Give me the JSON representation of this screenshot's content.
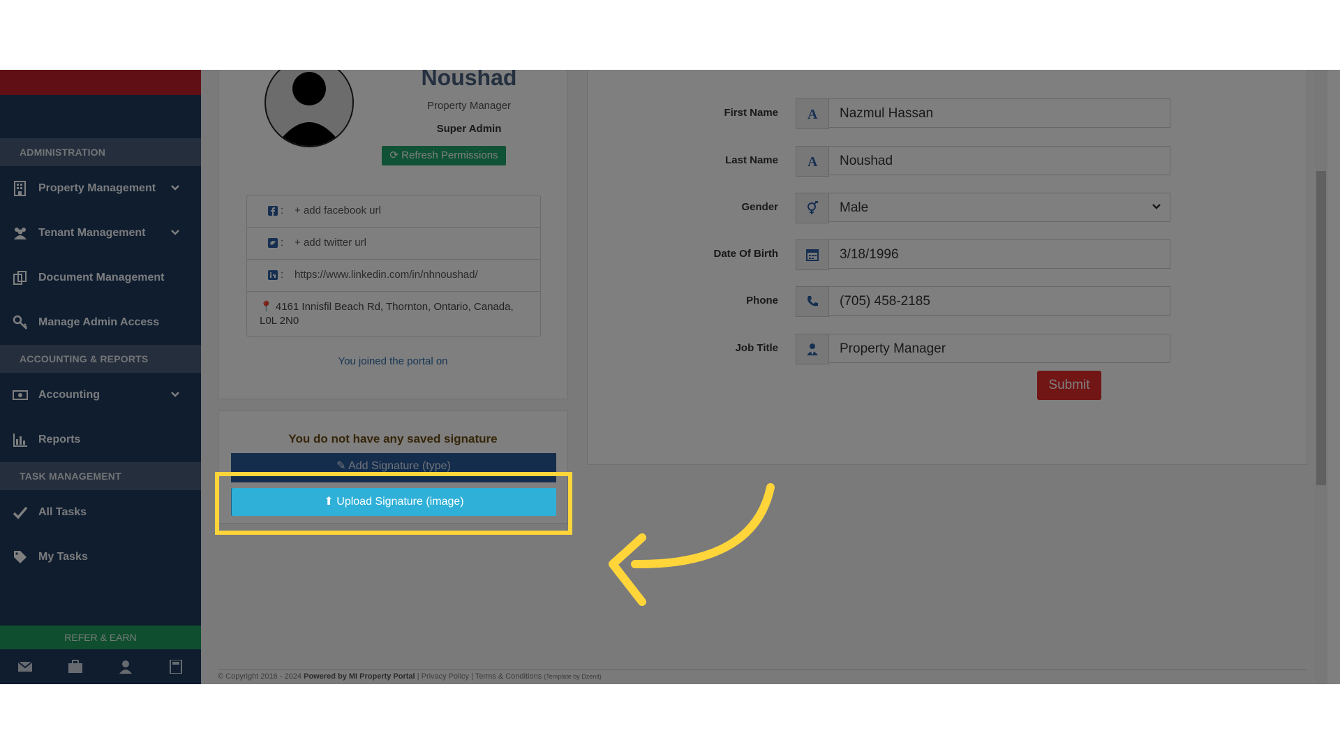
{
  "sidebar": {
    "sections": {
      "administration": "ADMINISTRATION",
      "accounting": "ACCOUNTING & REPORTS",
      "tasks": "TASK MANAGEMENT"
    },
    "items": {
      "property_management": "Property Management",
      "tenant_management": "Tenant Management",
      "document_management": "Document Management",
      "manage_admin_access": "Manage Admin Access",
      "accounting": "Accounting",
      "reports": "Reports",
      "all_tasks": "All Tasks",
      "my_tasks": "My Tasks"
    },
    "refer_label": "REFER & EARN"
  },
  "profile": {
    "name": "Noushad",
    "role": "Property Manager",
    "admin_label": "Super Admin",
    "refresh_label": "Refresh Permissions",
    "facebook": "add facebook url",
    "twitter": "add twitter url",
    "linkedin": "https://www.linkedin.com/in/nhnoushad/",
    "address": "4161 Innisfil Beach Rd, Thornton, Ontario, Canada, L0L 2N0",
    "joined": "You joined the portal on"
  },
  "signature": {
    "empty_text": "You do not have any saved signature",
    "add_label": "Add Signature (type)",
    "upload_label": "Upload Signature (image)"
  },
  "form": {
    "first_name": {
      "label": "First Name",
      "value": "Nazmul Hassan"
    },
    "last_name": {
      "label": "Last Name",
      "value": "Noushad"
    },
    "gender": {
      "label": "Gender",
      "value": "Male"
    },
    "dob": {
      "label": "Date Of Birth",
      "value": "3/18/1996"
    },
    "phone": {
      "label": "Phone",
      "value": "(705) 458-2185"
    },
    "job_title": {
      "label": "Job Title",
      "value": "Property Manager"
    },
    "submit_label": "Submit"
  },
  "footer": {
    "copyright": "© Copyright 2016 - 2024",
    "powered": "Powered by MI Property Portal",
    "links": "| Privacy Policy | Terms & Conditions",
    "template": "(Template by Dzenit)"
  },
  "colors": {
    "highlight": "#ffd53a",
    "accent_green": "#1ea56a",
    "submit_red": "#e32b2b"
  }
}
